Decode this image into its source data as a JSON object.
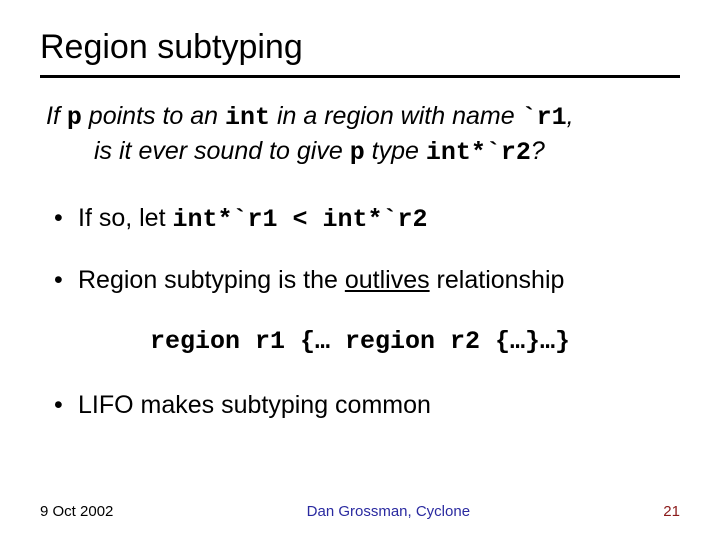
{
  "title": "Region subtyping",
  "lead": {
    "pre1": "If ",
    "p": "p",
    "mid1": " points to an ",
    "int": "int",
    "mid2": " in a region with name ",
    "r1": "`r1",
    "comma": ",",
    "line2a": "is it ever sound to give ",
    "p2": "p",
    "mid3": " type ",
    "type": "int*`r2",
    "q": "?"
  },
  "bullet1": {
    "pre": "If so, let ",
    "lhs": "int*`r1",
    "op": " < ",
    "rhs": "int*`r2"
  },
  "bullet2": {
    "pre": "Region subtyping is the ",
    "u": "outlives",
    "post": " relationship"
  },
  "codeblock": "region r1 {… region r2 {…}…}",
  "bullet3": "LIFO makes subtyping common",
  "footer": {
    "date": "9 Oct 2002",
    "author": "Dan Grossman, Cyclone",
    "page": "21"
  }
}
